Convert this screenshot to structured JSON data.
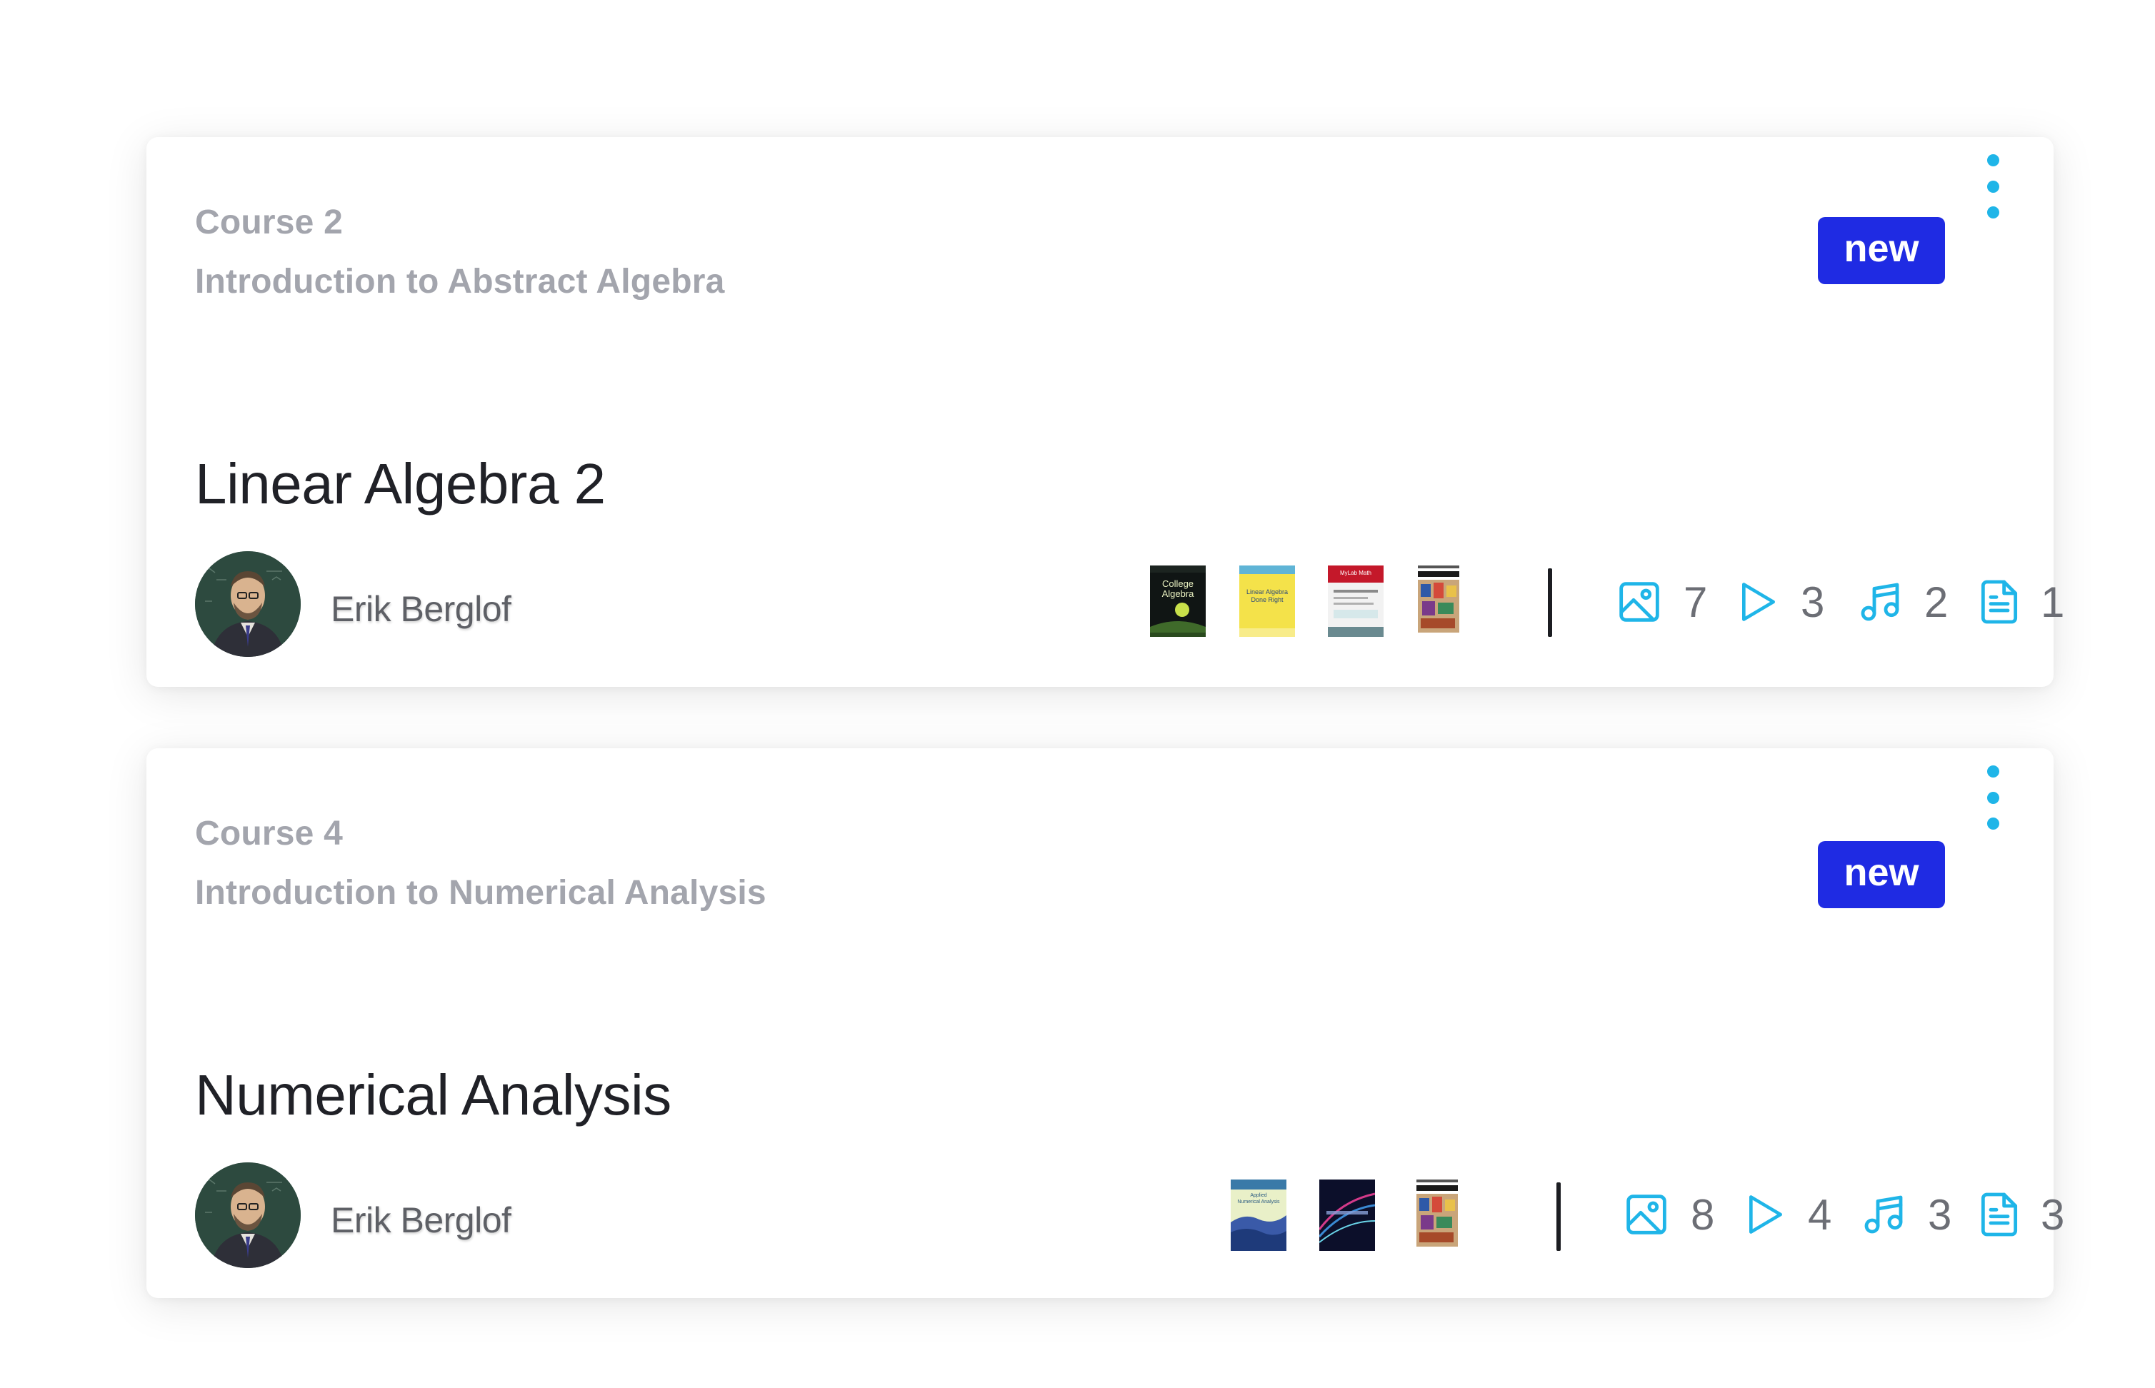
{
  "colors": {
    "badge": "#1f2be3",
    "accent_icon": "#1fb5e8",
    "muted_text": "#a3a5ad",
    "title_text": "#202127"
  },
  "courses": [
    {
      "course_number": "Course 2",
      "subtitle": "Introduction to Abstract Algebra",
      "badge": "new",
      "title": "Linear Algebra 2",
      "author": "Erik Berglof",
      "book_covers": [
        "College Algebra",
        "Linear Algebra Done Right",
        "MyLab Math",
        "textbook-cover"
      ],
      "stats": {
        "images": "7",
        "videos": "3",
        "audio": "2",
        "documents": "1"
      }
    },
    {
      "course_number": "Course 4",
      "subtitle": "Introduction to Numerical Analysis",
      "badge": "new",
      "title": "Numerical Analysis",
      "author": "Erik Berglof",
      "book_covers": [
        "Applied Numerical Analysis",
        "numerical-analysis-cover",
        "textbook-cover"
      ],
      "stats": {
        "images": "8",
        "videos": "4",
        "audio": "3",
        "documents": "3"
      }
    }
  ],
  "icons": {
    "menu": "kebab-menu-icon",
    "images": "image-icon",
    "videos": "play-icon",
    "audio": "music-note-icon",
    "documents": "document-icon"
  }
}
